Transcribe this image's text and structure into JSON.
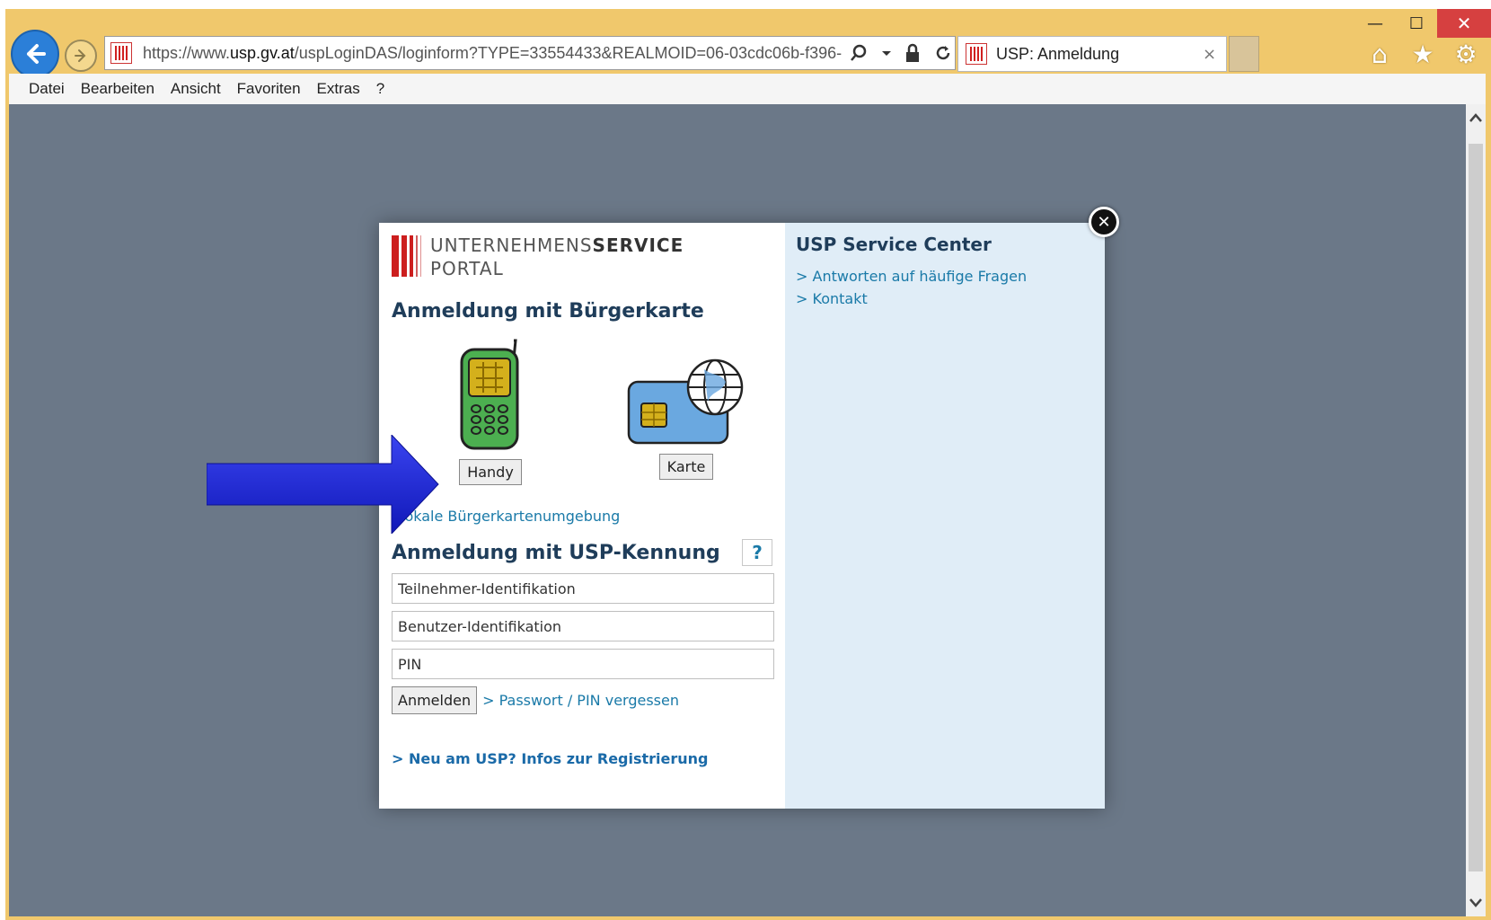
{
  "window": {
    "minimize": "—",
    "maximize": "☐",
    "close": "✕"
  },
  "address": {
    "url_prefix": "https://www.",
    "url_domain": "usp.gv.at",
    "url_path": "/uspLoginDAS/loginform?TYPE=33554433&REALMOID=06-03cdc06b-f396-"
  },
  "tab": {
    "title": "USP: Anmeldung",
    "close": "×"
  },
  "menu": [
    "Datei",
    "Bearbeiten",
    "Ansicht",
    "Favoriten",
    "Extras",
    "?"
  ],
  "modal": {
    "logo_line1_light": "UNTERNEHMENS",
    "logo_line1_bold": "SERVICE",
    "logo_line2": "PORTAL",
    "buergerkarte_heading": "Anmeldung mit Bürgerkarte",
    "handy_button": "Handy",
    "karte_button": "Karte",
    "lokale_link": "lokale Bürgerkartenumgebung",
    "usp_heading": "Anmeldung mit USP-Kennung",
    "help_label": "?",
    "teilnehmer_placeholder": "Teilnehmer-Identifikation",
    "benutzer_placeholder": "Benutzer-Identifikation",
    "pin_placeholder": "PIN",
    "login_button": "Anmelden",
    "forgot_link": "> Passwort / PIN vergessen",
    "register_link": ">  Neu am USP? Infos zur Registrierung",
    "close_label": "✕"
  },
  "service_center": {
    "title": "USP Service Center",
    "links": [
      "> Antworten auf häufige Fragen",
      "> Kontakt"
    ]
  },
  "colors": {
    "browser_frame": "#f0c86c",
    "overlay": "#6b7888",
    "heading": "#1f3d5a",
    "link": "#1a7aa8",
    "brand_red": "#cc1e1e",
    "service_panel": "#e0edf7",
    "arrow_blue": "#1a22d8"
  }
}
